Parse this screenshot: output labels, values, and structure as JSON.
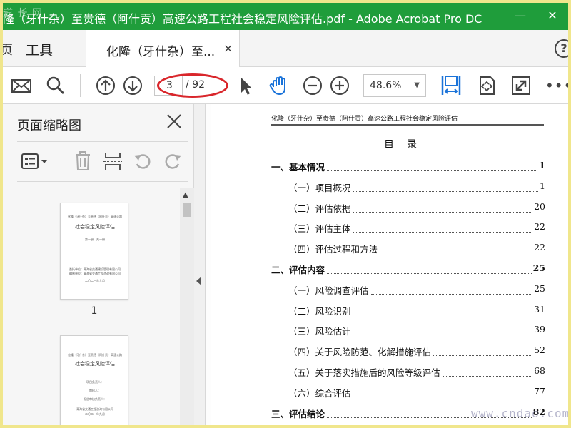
{
  "window": {
    "title": "隆（牙什杂）至贵德（阿什贡）高速公路工程社会稳定风险评估.pdf - Adobe Acrobat Pro DC",
    "watermark_top": "道 长 网",
    "minimize": "—",
    "close": "✕"
  },
  "tabs": {
    "left_stub": "页",
    "tools": "工具",
    "doc_tab": "化隆（牙什杂）至...",
    "doc_tab_close": "×",
    "help": "?"
  },
  "toolbar": {
    "icons": [
      "mail-icon",
      "search-icon",
      "arrow-up-circle-icon",
      "arrow-down-circle-icon",
      "select-arrow-icon",
      "hand-icon",
      "zoom-out-icon",
      "zoom-in-icon",
      "fit-width-icon",
      "rotate-icon",
      "fullscreen-icon"
    ],
    "page_current": "3",
    "page_total": "/ 92",
    "zoom": "48.6%",
    "more": "•••",
    "accent_color": "#1a73d9",
    "highlight_color": "#d9262b"
  },
  "left_panel": {
    "title": "页面缩略图",
    "thumbnails": [
      {
        "number": "1",
        "lines": [
          "化隆（牙什杂）至贵德（阿什贡）高速公路工程",
          "社会稳定风险评估",
          "第一册　共一册",
          "委托单位：青海省交通建设管理有限公司",
          "编制单位：青海省交通工程咨询有限公司",
          "二〇二一年九月"
        ]
      },
      {
        "number": "",
        "lines": [
          "化隆（牙什杂）至贵德（阿什贡）高速公路工程",
          "社会稳定风险评估",
          "项目负责人：",
          "审核人：",
          "报告审核负责人：",
          "青海省交通工程咨询有限公司",
          "二〇二一年九月"
        ]
      }
    ]
  },
  "document": {
    "header": "化隆（牙什杂）至贵德（阿什贡）高速公路工程社会稳定风险评估",
    "toc_title": "目录",
    "toc": [
      {
        "level": 1,
        "label": "一、基本情况",
        "page": "1"
      },
      {
        "level": 2,
        "label": "（一）项目概况",
        "page": "1"
      },
      {
        "level": 2,
        "label": "（二）评估依据",
        "page": "20"
      },
      {
        "level": 2,
        "label": "（三）评估主体",
        "page": "22"
      },
      {
        "level": 2,
        "label": "（四）评估过程和方法",
        "page": "22"
      },
      {
        "level": 1,
        "label": "二、评估内容",
        "page": "25"
      },
      {
        "level": 2,
        "label": "（一）风险调查评估",
        "page": "25"
      },
      {
        "level": 2,
        "label": "（二）风险识别",
        "page": "31"
      },
      {
        "level": 2,
        "label": "（三）风险估计",
        "page": "39"
      },
      {
        "level": 2,
        "label": "（四）关于风险防范、化解措施评估",
        "page": "52"
      },
      {
        "level": 2,
        "label": "（五）关于落实措施后的风险等级评估",
        "page": "68"
      },
      {
        "level": 2,
        "label": "（六）综合评估",
        "page": "77"
      },
      {
        "level": 1,
        "label": "三、评估结论",
        "page": "82"
      }
    ]
  },
  "watermark_bottom": "www.cndao.com"
}
